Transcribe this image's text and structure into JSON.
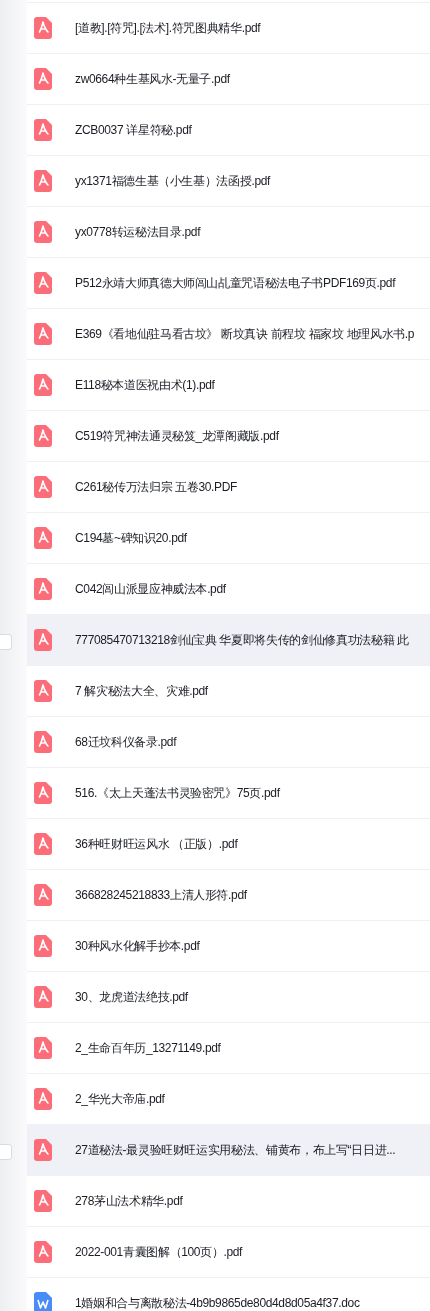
{
  "files": [
    {
      "name": "[道教].[符咒].[法术].符咒图典精华.pdf",
      "kind": "pdf",
      "hovered": false
    },
    {
      "name": "zw0664种生基风水-无量子.pdf",
      "kind": "pdf",
      "hovered": false
    },
    {
      "name": "ZCB0037 详星符秘.pdf",
      "kind": "pdf",
      "hovered": false
    },
    {
      "name": "yx1371福德生基（小生基）法函授.pdf",
      "kind": "pdf",
      "hovered": false
    },
    {
      "name": "yx0778转运秘法目录.pdf",
      "kind": "pdf",
      "hovered": false
    },
    {
      "name": "P512永靖大师真德大师闾山乩童咒语秘法电子书PDF169页.pdf",
      "kind": "pdf",
      "hovered": false
    },
    {
      "name": "E369《看地仙驻马看古坟》 断坟真诀 前程坟 福家坟 地理风水书.p",
      "kind": "pdf",
      "hovered": false
    },
    {
      "name": "E118秘本道医祝由术(1).pdf",
      "kind": "pdf",
      "hovered": false
    },
    {
      "name": "C519符咒神法通灵秘笈_龙潭阁藏版.pdf",
      "kind": "pdf",
      "hovered": false
    },
    {
      "name": "C261秘传万法归宗 五卷30.PDF",
      "kind": "pdf",
      "hovered": false
    },
    {
      "name": "C194墓~碑知识20.pdf",
      "kind": "pdf",
      "hovered": false
    },
    {
      "name": "C042闾山派显应神威法本.pdf",
      "kind": "pdf",
      "hovered": false
    },
    {
      "name": "777085470713218剑仙宝典 华夏即将失传的剑仙修真功法秘籍 此",
      "kind": "pdf",
      "hovered": true
    },
    {
      "name": "7 解灾秘法大全、灾难.pdf",
      "kind": "pdf",
      "hovered": false
    },
    {
      "name": "68迁坟科仪备录.pdf",
      "kind": "pdf",
      "hovered": false
    },
    {
      "name": "516.《太上天蓬法书灵验密咒》75页.pdf",
      "kind": "pdf",
      "hovered": false
    },
    {
      "name": "36种旺财旺运风水 （正版）.pdf",
      "kind": "pdf",
      "hovered": false
    },
    {
      "name": "366828245218833上清人形符.pdf",
      "kind": "pdf",
      "hovered": false
    },
    {
      "name": "30种风水化解手抄本.pdf",
      "kind": "pdf",
      "hovered": false
    },
    {
      "name": "30、龙虎道法绝技.pdf",
      "kind": "pdf",
      "hovered": false
    },
    {
      "name": "2_生命百年历_13271149.pdf",
      "kind": "pdf",
      "hovered": false
    },
    {
      "name": "2_华光大帝庙.pdf",
      "kind": "pdf",
      "hovered": false
    },
    {
      "name": "27道秘法-最灵验旺财旺运实用秘法、铺黄布，布上写“日日进...",
      "kind": "pdf",
      "hovered": true
    },
    {
      "name": "278茅山法术精华.pdf",
      "kind": "pdf",
      "hovered": false
    },
    {
      "name": "2022-001青囊图解（100页）.pdf",
      "kind": "pdf",
      "hovered": false
    },
    {
      "name": "1婚姻和合与离散秘法-4b9b9865de80d4d8d05a4f37.doc",
      "kind": "doc",
      "hovered": false
    }
  ]
}
